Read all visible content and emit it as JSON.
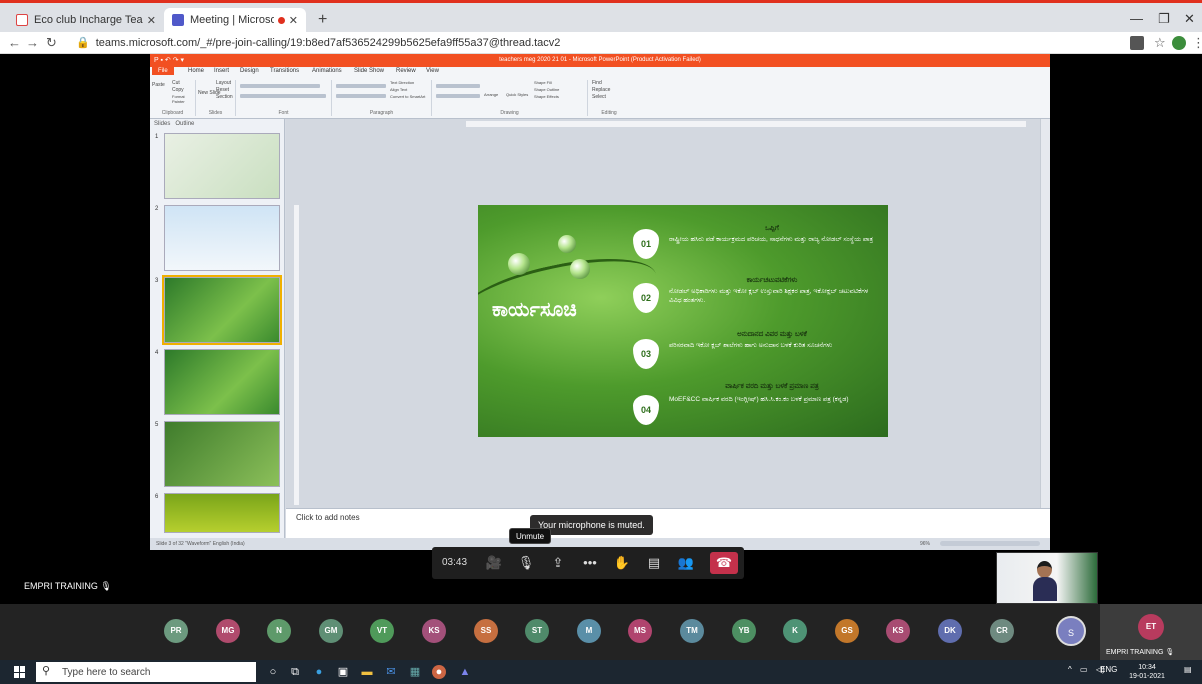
{
  "browser": {
    "tabs": [
      {
        "label": "Eco club Incharge Teachers Onlin"
      },
      {
        "label": "Meeting | Microsoft Teams"
      }
    ],
    "new_tab": "+",
    "url": "teams.microsoft.com/_#/pre-join-calling/19:b8ed7af536524299b5625efa9ff55a37@thread.tacv2"
  },
  "ppt": {
    "window_title": "teachers meg 2020 21 01 - Microsoft PowerPoint (Product Activation Failed)",
    "ribbon_tabs": [
      "File",
      "Home",
      "Insert",
      "Design",
      "Transitions",
      "Animations",
      "Slide Show",
      "Review",
      "View"
    ],
    "ribbon_groups": [
      "Clipboard",
      "Slides",
      "Font",
      "Paragraph",
      "Drawing",
      "Editing"
    ],
    "ribbon_small": {
      "cut": "Cut",
      "copy": "Copy",
      "paste": "Paste",
      "format_painter": "Format Painter",
      "new_slide": "New Slide",
      "layout": "Layout",
      "reset": "Reset",
      "section": "Section",
      "find": "Find",
      "replace": "Replace",
      "select": "Select",
      "text_direction": "Text Direction",
      "align_text": "Align Text",
      "convert_smartart": "Convert to SmartArt",
      "arrange": "Arrange",
      "quick_styles": "Quick Styles",
      "shape_fill": "Shape Fill",
      "shape_outline": "Shape Outline",
      "shape_effects": "Shape Effects"
    },
    "pane_tabs": {
      "slides": "Slides",
      "outline": "Outline"
    },
    "thumb_numbers": [
      "1",
      "2",
      "3",
      "4",
      "5",
      "6"
    ],
    "slide": {
      "title": "ಕಾರ್ಯಸೂಚಿ",
      "items": [
        {
          "num": "01",
          "head": "ಒಪ್ಪಿಗೆ",
          "body": "ರಾಷ್ಟ್ರೀಯ ಹಸಿರು ಪಡೆ ಕಾರ್ಯಕ್ರಮದ ಪರಿಚಯ, ಸಾಧನೆಗಳು ಮತ್ತು ರಾಜ್ಯ ನೋಡಲ್ ಸಂಸ್ಥೆಯ ಪಾತ್ರ"
        },
        {
          "num": "02",
          "head": "ಕಾರ್ಯಚಟುವಟಿಕೆಗಳು",
          "body": "ನೋಡಲ್ ಅಧಿಕಾರಿಗಳು ಮತ್ತು ಇಕೋ ಕ್ಲಬ್ ಉಸ್ತುವಾರಿ ಶಿಕ್ಷಕರ ಪಾತ್ರ, ಇಕೋಕ್ಲಬ್ ಚಟುವಟಿಕೆಗಳ ವಿವಿಧ ಹಂತಗಳು."
        },
        {
          "num": "03",
          "head": "ಅನುದಾನದ ವಿವರ ಮತ್ತು ಬಳಕೆ",
          "body": "ಪರಿಸರವಾದಿ ಇಕೋ ಕ್ಲಬ್ ಶಾಲೆಗಳು ಹಾಗು ಅನುದಾನ ಬಳಕೆ ಕುರಿತ ಸೂಚನೆಗಳು"
        },
        {
          "num": "04",
          "head": "ವಾರ್ಷಿಕ ವರದಿ ಮತ್ತು ಬಳಕೆ ಪ್ರಮಾಣ ಪತ್ರ",
          "body": "MoEF&CC ವಾರ್ಷಿಕ ವರದಿ (ಇಂಗ್ಲೀಷ್) ಹಸಿ.ಸಿ.ಕಂ.ಕಂ ಬಳಕೆ ಪ್ರಮಾಣ ಪತ್ರ (ಕನ್ನಡ)"
        }
      ]
    },
    "notes_placeholder": "Click to add notes",
    "status_text": "Slide 3 of 32   \"Waveform\"   English (India)",
    "zoom": "96%"
  },
  "teams": {
    "muted_tooltip": "Your microphone is muted.",
    "unmute_tooltip": "Unmute",
    "call_duration": "03:43",
    "presenter_label": "EMPRI TRAINING",
    "participants": [
      "PR",
      "MG",
      "N",
      "GM",
      "VT",
      "KS",
      "SS",
      "ST",
      "M",
      "MS",
      "TM",
      "YB",
      "K",
      "GS",
      "KS",
      "DK",
      "CR"
    ],
    "self_initial": "S",
    "tile": {
      "initials": "ET",
      "label": "EMPRI TRAINING"
    },
    "colors": {
      "participant_bg": [
        "#6c9a7f",
        "#b04b6d",
        "#5e9a6a",
        "#5f8f75",
        "#4f9a5a",
        "#a3507a",
        "#c66f40",
        "#4f8a6a",
        "#5a8fa8",
        "#b0446e",
        "#5b8a9d",
        "#4d8f62",
        "#4e9375",
        "#c2772a",
        "#a84c72",
        "#5f6dae",
        "#6e8a80"
      ]
    }
  },
  "taskbar": {
    "search_placeholder": "Type here to search",
    "lang": "ENG",
    "time": "10:34",
    "date": "19-01-2021"
  }
}
